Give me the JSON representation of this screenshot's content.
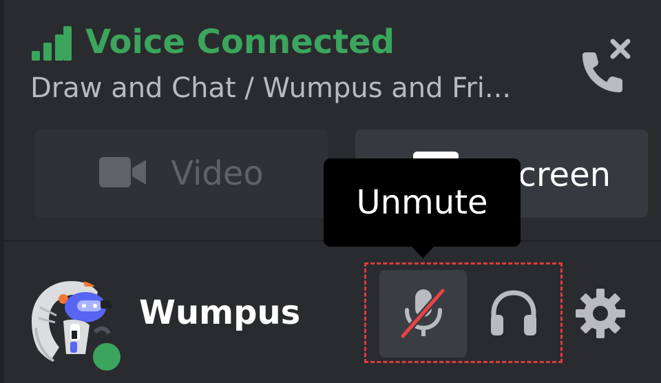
{
  "voice": {
    "status": "Voice Connected",
    "channel": "Draw and Chat / Wumpus and Fri...",
    "status_color": "#3ba55d",
    "subtitle_color": "#b9bbbe",
    "signal_icon": "signal-strength-icon",
    "disconnect_icon": "phone-hangup-icon"
  },
  "actions": {
    "video_label": "Video",
    "video_icon": "camera-icon",
    "screen_label": "Screen",
    "screen_icon": "screen-share-icon"
  },
  "tooltip": {
    "text": "Unmute"
  },
  "user": {
    "name": "Wumpus",
    "status": "online",
    "status_color": "#3ba55d",
    "avatar_icon": "wumpus-avatar"
  },
  "controls": {
    "mic_icon": "microphone-muted-icon",
    "mic_muted": true,
    "headset_icon": "headphones-icon",
    "settings_icon": "gear-icon",
    "highlight_color": "#e03c3c"
  }
}
